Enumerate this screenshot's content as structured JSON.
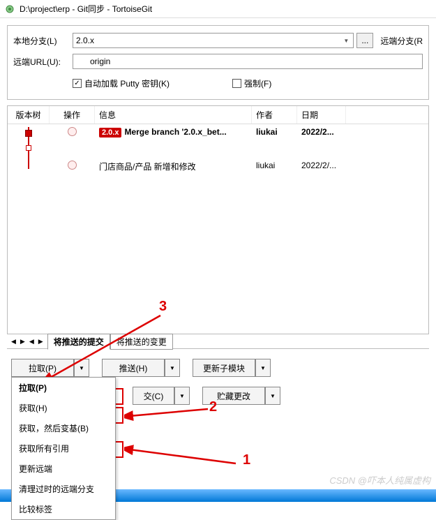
{
  "title": "D:\\project\\erp - Git同步 - TortoiseGit",
  "form": {
    "local_branch_label": "本地分支(L)",
    "local_branch_value": "2.0.x",
    "browse_label": "...",
    "remote_branch_label": "远端分支(R",
    "remote_url_label": "远端URL(U):",
    "remote_url_value": "origin",
    "auto_load_putty": "自动加载 Putty 密钥(K)",
    "force": "强制(F)"
  },
  "columns": {
    "graph": "版本树",
    "op": "操作",
    "info": "信息",
    "author": "作者",
    "date": "日期"
  },
  "commits": [
    {
      "tag": "2.0.x",
      "msg": "Merge branch '2.0.x_bet...",
      "author": "liukai",
      "date": "2022/2...",
      "bold": true
    },
    {
      "tag": "",
      "msg": "门店商品/产品 新增和修改",
      "author": "liukai",
      "date": "2022/2/...",
      "bold": false
    }
  ],
  "tabs": {
    "outgoing_commits": "将推送的提交",
    "outgoing_changes": "将推送的变更"
  },
  "buttons": {
    "pull": "拉取(P)",
    "push": "推送(H)",
    "submodule": "更新子模块",
    "commit": "交(C)",
    "stash": "贮藏更改"
  },
  "menu": {
    "items": [
      {
        "label": "拉取(P)",
        "bold": true
      },
      {
        "label": "获取(H)",
        "bold": false
      },
      {
        "label": "获取，然后变基(B)",
        "bold": false
      },
      {
        "label": "获取所有引用",
        "bold": false
      },
      {
        "label": "更新远端",
        "bold": false
      },
      {
        "label": "清理过时的远端分支",
        "bold": false
      },
      {
        "label": "比较标签",
        "bold": false
      }
    ]
  },
  "annotations": {
    "n1": "1",
    "n2": "2",
    "n3": "3"
  },
  "watermark": "CSDN @吓本人纯属虚构"
}
